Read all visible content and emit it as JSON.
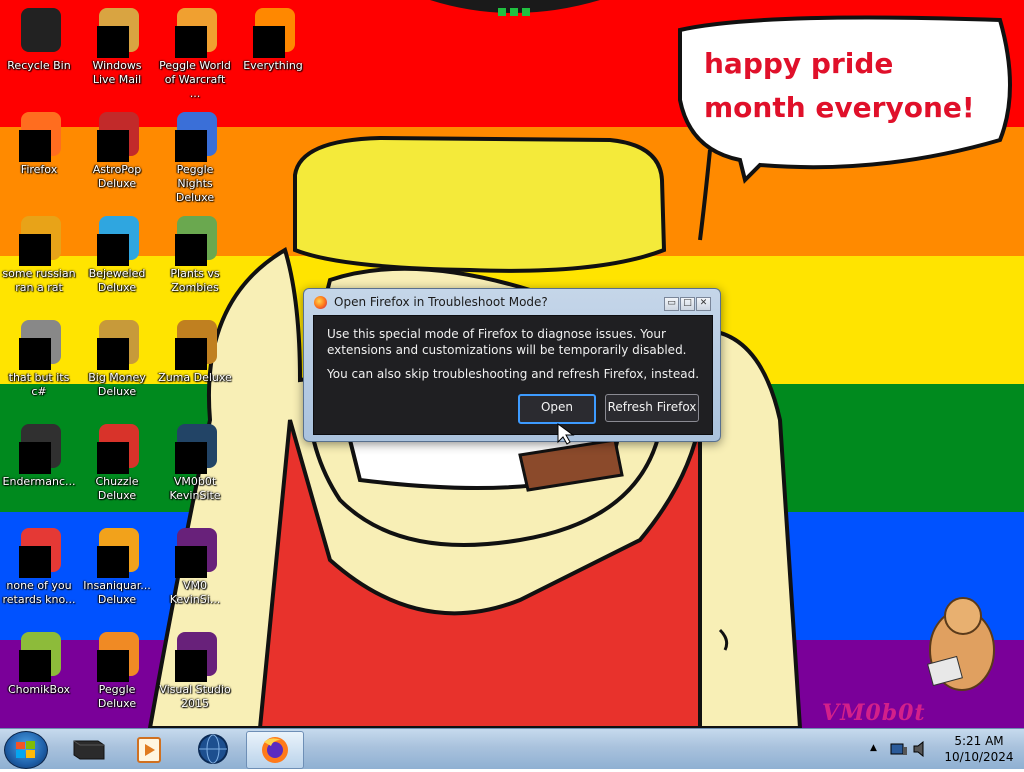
{
  "desktop": {
    "rainbow_colors": [
      "#ff0000",
      "#ff8a00",
      "#ffe400",
      "#008a1e",
      "#0052ff",
      "#7a0099"
    ],
    "speech_bubble_text": "happy pride month everyone!",
    "watermark": "VM0b0t",
    "icons": [
      {
        "label": "Recycle Bin",
        "icon": "recycle-bin-icon",
        "color": "#222222"
      },
      {
        "label": "Windows Live Mail",
        "icon": "mail-icon",
        "color": "#d9a441"
      },
      {
        "label": "Peggle World of Warcraft ...",
        "icon": "peggle-wow-icon",
        "color": "#f0a030"
      },
      {
        "label": "Everything",
        "icon": "search-icon",
        "color": "#ff8800"
      },
      {
        "label": "Firefox",
        "icon": "firefox-icon",
        "color": "#ff6d1f"
      },
      {
        "label": "AstroPop Deluxe",
        "icon": "astropop-icon",
        "color": "#c22a2a"
      },
      {
        "label": "Peggle Nights Deluxe",
        "icon": "peggle-nights-icon",
        "color": "#3a6fd8"
      },
      {
        "label": "some russian ran a rat",
        "icon": "russian-app-icon",
        "color": "#e8a318"
      },
      {
        "label": "Bejeweled Deluxe",
        "icon": "bejeweled-icon",
        "color": "#2fa6e0"
      },
      {
        "label": "Plants vs Zombies",
        "icon": "plants-vs-zombies-icon",
        "color": "#6aa84f"
      },
      {
        "label": "that but its c#",
        "icon": "csharp-app-icon",
        "color": "#888888"
      },
      {
        "label": "Big Money Deluxe",
        "icon": "big-money-icon",
        "color": "#c79a3a"
      },
      {
        "label": "Zuma Deluxe",
        "icon": "zuma-icon",
        "color": "#c08020"
      },
      {
        "label": "Endermanc...",
        "icon": "enderman-icon",
        "color": "#303030"
      },
      {
        "label": "Chuzzle Deluxe",
        "icon": "chuzzle-icon",
        "color": "#d8332a"
      },
      {
        "label": "VM0b0t KevinSite",
        "icon": "kevinsite-icon",
        "color": "#224466"
      },
      {
        "label": "none of you retards kno...",
        "icon": "chrome-like-icon",
        "color": "#e53935"
      },
      {
        "label": "Insaniquar... Deluxe",
        "icon": "insaniquarium-icon",
        "color": "#f2a21b"
      },
      {
        "label": "VM0 KevinSi...",
        "icon": "visual-studio-kevinsite-icon",
        "color": "#68217a"
      },
      {
        "label": "ChomikBox",
        "icon": "chomikbox-icon",
        "color": "#8dbb3a"
      },
      {
        "label": "Peggle Deluxe",
        "icon": "peggle-icon",
        "color": "#f08a24"
      },
      {
        "label": "Visual Studio 2015",
        "icon": "visual-studio-icon",
        "color": "#68217a"
      }
    ]
  },
  "dialog": {
    "title": "Open Firefox in Troubleshoot Mode?",
    "message_1": "Use this special mode of Firefox to diagnose issues. Your extensions and customizations will be temporarily disabled.",
    "message_2": "You can also skip troubleshooting and refresh Firefox, instead.",
    "open_button": "Open",
    "refresh_button": "Refresh Firefox",
    "minimize_glyph": "▭",
    "maximize_glyph": "□",
    "close_glyph": "✕"
  },
  "taskbar": {
    "pinned": [
      {
        "icon": "program-icon"
      },
      {
        "icon": "media-player-icon"
      },
      {
        "icon": "network-globe-icon"
      },
      {
        "icon": "firefox-icon",
        "active": true
      }
    ],
    "tray_icons": [
      "show-hidden-icon",
      "network-icon",
      "volume-icon"
    ],
    "clock_time": "5:21 AM",
    "clock_date": "10/10/2024"
  }
}
